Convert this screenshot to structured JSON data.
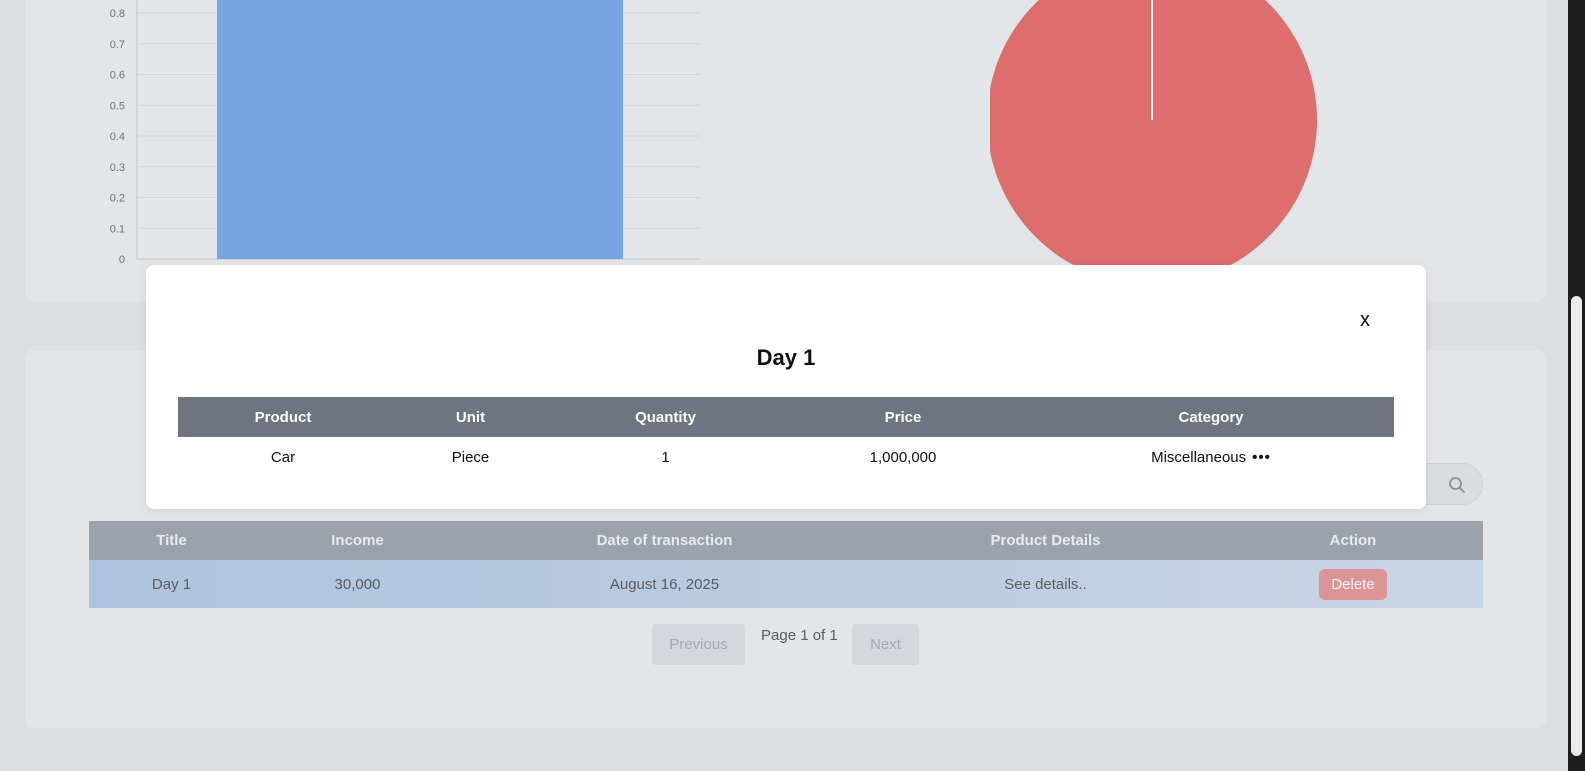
{
  "bar_chart": {
    "chart_data": {
      "type": "bar",
      "categories": [
        ""
      ],
      "values": [
        1
      ],
      "title": "",
      "xlabel": "",
      "ylabel": "",
      "ylim": [
        0,
        0.8
      ],
      "yticks": [
        "0.8",
        "0.7",
        "0.6",
        "0.5",
        "0.4",
        "0.3",
        "0.2",
        "0.1",
        "0"
      ],
      "grid": true,
      "color": "#75a7e8"
    }
  },
  "pie_chart": {
    "chart_data": {
      "type": "pie",
      "labels": [
        ""
      ],
      "values": [
        1
      ],
      "color": "#e66b6d"
    }
  },
  "transactions": {
    "headers": [
      "Title",
      "Income",
      "Date of transaction",
      "Product Details",
      "Action"
    ],
    "rows": [
      {
        "title": "Day 1",
        "income": "30,000",
        "date": "August 16, 2025",
        "details": "See details..",
        "action": "Delete"
      }
    ]
  },
  "pagination": {
    "previous": "Previous",
    "page_text": "Page 1 of 1",
    "next": "Next"
  },
  "modal": {
    "close": "x",
    "title": "Day 1",
    "headers": [
      "Product",
      "Unit",
      "Quantity",
      "Price",
      "Category"
    ],
    "rows": [
      {
        "product": "Car",
        "unit": "Piece",
        "quantity": "1",
        "price": "1,000,000",
        "category": "Miscellaneous",
        "more": "•••"
      }
    ]
  },
  "icons": {
    "search": "search-icon",
    "more": "more-horizontal-icon"
  },
  "colors": {
    "delete": "#e59597",
    "modal_header": "#6e7480",
    "table_header": "#9ea4ae"
  }
}
